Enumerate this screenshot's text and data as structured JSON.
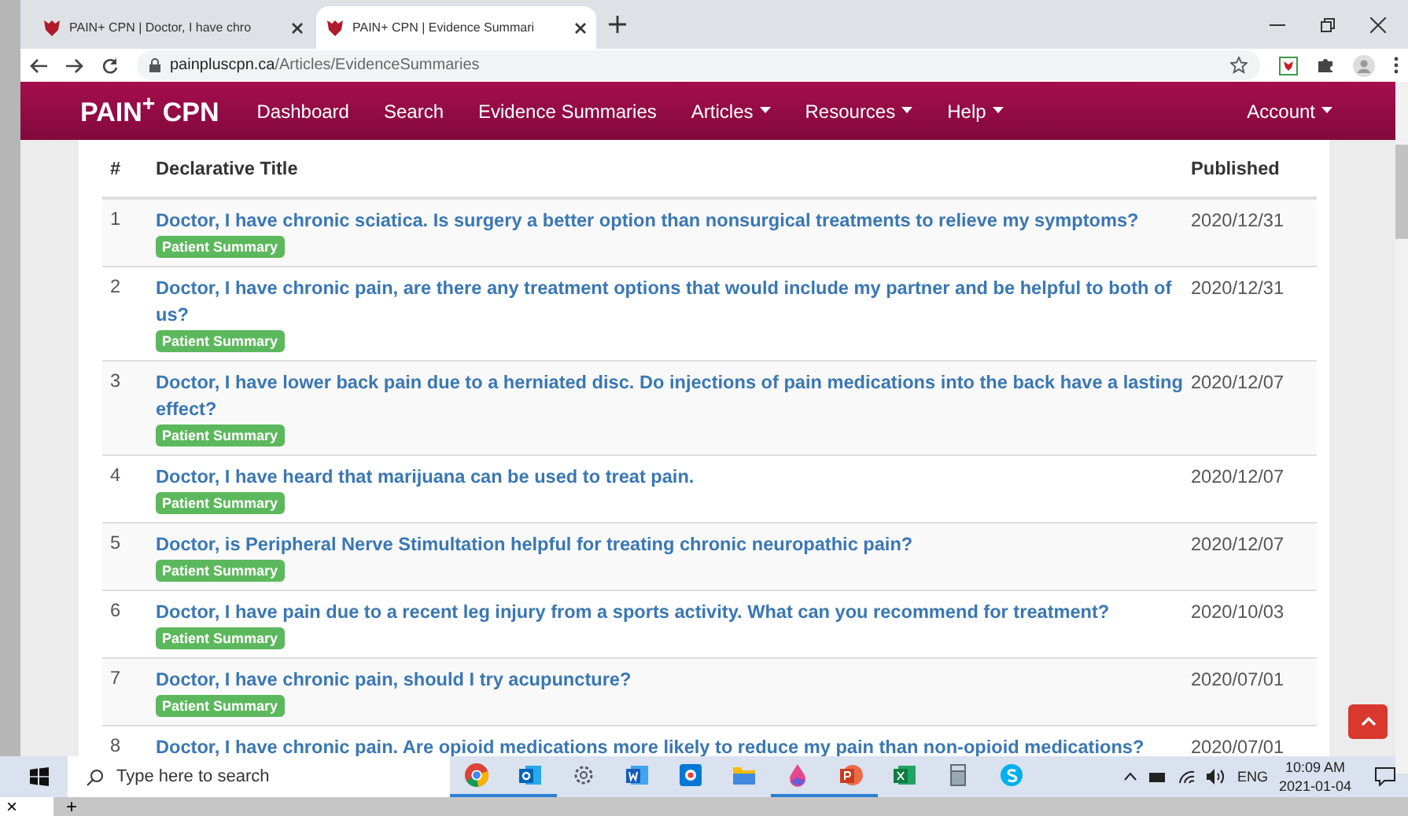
{
  "browser": {
    "tabs": [
      {
        "title": "PAIN+ CPN | Doctor, I have chro",
        "selected": false
      },
      {
        "title": "PAIN+ CPN | Evidence Summari",
        "selected": true
      }
    ],
    "url_host": "painpluscpn.ca",
    "url_path": "/Articles/EvidenceSummaries"
  },
  "site": {
    "brand": "PAIN",
    "brand_sup": "+",
    "brand_rest": "CPN",
    "nav": [
      {
        "label": "Dashboard",
        "has_menu": false
      },
      {
        "label": "Search",
        "has_menu": false
      },
      {
        "label": "Evidence Summaries",
        "has_menu": false
      },
      {
        "label": "Articles",
        "has_menu": true
      },
      {
        "label": "Resources",
        "has_menu": true
      },
      {
        "label": "Help",
        "has_menu": true
      }
    ],
    "account": {
      "label": "Account",
      "has_menu": true
    }
  },
  "table": {
    "columns": [
      "#",
      "Declarative Title",
      "Published"
    ],
    "rows": [
      {
        "num": "1",
        "title": "Doctor, I have chronic sciatica. Is surgery a better option than nonsurgical treatments to relieve my symptoms?",
        "badge": "Patient Summary",
        "published": "2020/12/31"
      },
      {
        "num": "2",
        "title": "Doctor, I have chronic pain, are there any treatment options that would include my partner and be helpful to both of us?",
        "badge": "Patient Summary",
        "published": "2020/12/31"
      },
      {
        "num": "3",
        "title": "Doctor, I have lower back pain due to a herniated disc. Do injections of pain medications into the back have a lasting effect?",
        "badge": "Patient Summary",
        "published": "2020/12/07"
      },
      {
        "num": "4",
        "title": "Doctor, I have heard that marijuana can be used to treat pain.",
        "badge": "Patient Summary",
        "published": "2020/12/07"
      },
      {
        "num": "5",
        "title": "Doctor, is Peripheral Nerve Stimultation helpful for treating chronic neuropathic pain?",
        "badge": "Patient Summary",
        "published": "2020/12/07"
      },
      {
        "num": "6",
        "title": "Doctor, I have pain due to a recent leg injury from a sports activity. What can you recommend for treatment?",
        "badge": "Patient Summary",
        "published": "2020/10/03"
      },
      {
        "num": "7",
        "title": "Doctor, I have chronic pain, should I try acupuncture?",
        "badge": "Patient Summary",
        "published": "2020/07/01"
      },
      {
        "num": "8",
        "title": "Doctor, I have chronic pain. Are opioid medications more likely to reduce my pain than non-opioid medications?",
        "published": "2020/07/01"
      }
    ]
  },
  "taskbar": {
    "search_placeholder": "Type here to search",
    "apps": [
      {
        "kind": "chrome",
        "running": true
      },
      {
        "kind": "outlook",
        "running": true
      },
      {
        "kind": "gear",
        "running": false
      },
      {
        "kind": "word",
        "running": false
      },
      {
        "kind": "camera",
        "running": false
      },
      {
        "kind": "folder",
        "running": false
      },
      {
        "kind": "paint",
        "running": true
      },
      {
        "kind": "powerpoint",
        "running": true
      },
      {
        "kind": "excel",
        "running": false
      },
      {
        "kind": "calculator",
        "running": false
      },
      {
        "kind": "skype",
        "running": false
      }
    ],
    "language": "ENG",
    "time": "10:09 AM",
    "date": "2021-01-04"
  },
  "bottom_strip": {
    "close": "×",
    "add": "+"
  }
}
